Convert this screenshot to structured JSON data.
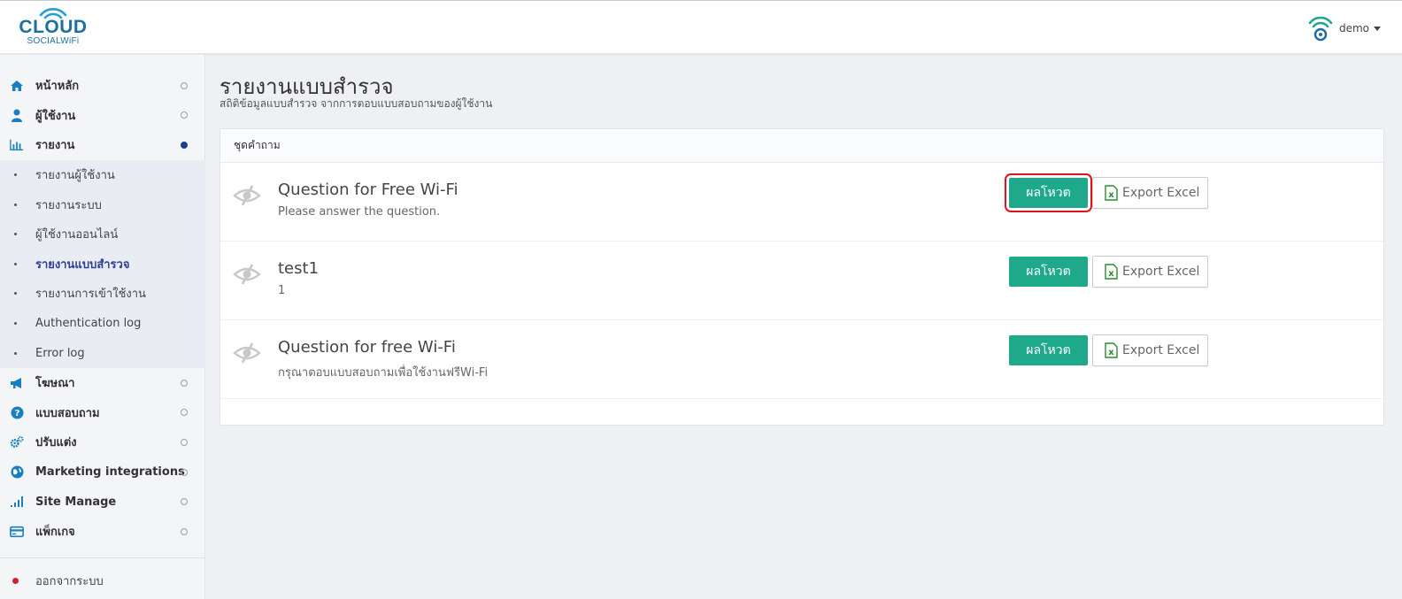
{
  "header": {
    "logo_word": "CLOUD",
    "logo_sub": "SOCIALWiFi",
    "user_name": "demo"
  },
  "sidebar": {
    "items": [
      {
        "label": "หน้าหลัก",
        "icon": "home-icon"
      },
      {
        "label": "ผู้ใช้งาน",
        "icon": "user-icon"
      },
      {
        "label": "รายงาน",
        "icon": "bar-chart-icon",
        "active": true
      },
      {
        "label": "โฆษณา",
        "icon": "megaphone-icon"
      },
      {
        "label": "แบบสอบถาม",
        "icon": "question-icon"
      },
      {
        "label": "ปรับแต่ง",
        "icon": "cogs-icon"
      },
      {
        "label": "Marketing integrations",
        "icon": "globe-icon"
      },
      {
        "label": "Site Manage",
        "icon": "signal-icon"
      },
      {
        "label": "แพ็กเกจ",
        "icon": "credit-card-icon"
      }
    ],
    "sub_items": [
      {
        "label": "รายงานผู้ใช้งาน"
      },
      {
        "label": "รายงานระบบ"
      },
      {
        "label": "ผู้ใช้งานออนไลน์"
      },
      {
        "label": "รายงานแบบสำรวจ",
        "current": true
      },
      {
        "label": "รายงานการเข้าใช้งาน"
      },
      {
        "label": "Authentication log"
      },
      {
        "label": "Error log"
      }
    ],
    "logout_label": "ออกจากระบบ"
  },
  "main": {
    "title": "รายงานแบบสำรวจ",
    "subtitle": "สถิติข้อมูลแบบสำรวจ จากการตอบแบบสอบถามของผู้ใช้งาน",
    "panel_heading": "ชุดคำถาม",
    "vote_label": "ผลโหวต",
    "excel_label": "Export Excel",
    "surveys": [
      {
        "title": "Question for Free Wi-Fi",
        "description": "Please answer the question."
      },
      {
        "title": "test1",
        "description": "1"
      },
      {
        "title": "Question for free Wi-Fi",
        "description": "กรุณาตอบแบบสอบถามเพื่อใช้งานฟรีWi-Fi"
      }
    ]
  },
  "colors": {
    "accent_green": "#1ea98a",
    "highlight_red": "#e0141a",
    "brand_blue": "#1d6f9e",
    "active_nav": "#2d3f96"
  }
}
